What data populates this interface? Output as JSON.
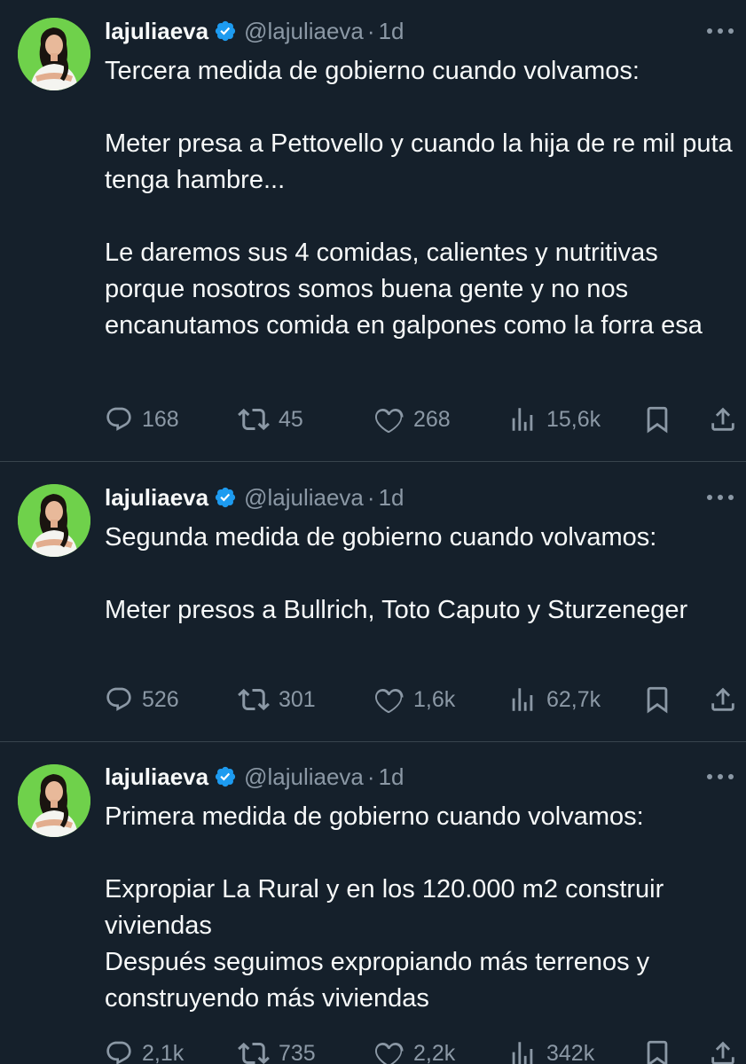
{
  "tweets": [
    {
      "name": "lajuliaeva",
      "handle": "@lajuliaeva",
      "separator": "·",
      "time": "1d",
      "paragraphs": [
        "Tercera medida de gobierno cuando volvamos:",
        "Meter presa a Pettovello y cuando la hija de re mil puta tenga hambre...",
        "Le daremos sus 4 comidas, calientes y nutritivas porque nosotros somos buena gente y no nos encanutamos comida en galpones como la forra esa"
      ],
      "replies": "168",
      "retweets": "45",
      "likes": "268",
      "views": "15,6k"
    },
    {
      "name": "lajuliaeva",
      "handle": "@lajuliaeva",
      "separator": "·",
      "time": "1d",
      "paragraphs": [
        "Segunda medida de gobierno cuando volvamos:",
        "Meter presos a Bullrich, Toto Caputo y Sturzeneger"
      ],
      "replies": "526",
      "retweets": "301",
      "likes": "1,6k",
      "views": "62,7k"
    },
    {
      "name": "lajuliaeva",
      "handle": "@lajuliaeva",
      "separator": "·",
      "time": "1d",
      "paragraphs": [
        "Primera medida de gobierno cuando volvamos:",
        "Expropiar La Rural y en los 120.000 m2 construir viviendas\nDespués seguimos expropiando más terrenos y construyendo más viviendas"
      ],
      "replies": "2,1k",
      "retweets": "735",
      "likes": "2,2k",
      "views": "342k"
    }
  ],
  "colors": {
    "background": "#15202b",
    "text": "#f7f9f9",
    "muted": "#8b98a5",
    "divider": "#38444d",
    "verified": "#1d9bf0",
    "avatar_bg": "#6fd14b"
  },
  "icons": [
    "verified-badge-icon",
    "more-icon",
    "reply-icon",
    "retweet-icon",
    "like-icon",
    "views-icon",
    "bookmark-icon",
    "share-icon"
  ]
}
